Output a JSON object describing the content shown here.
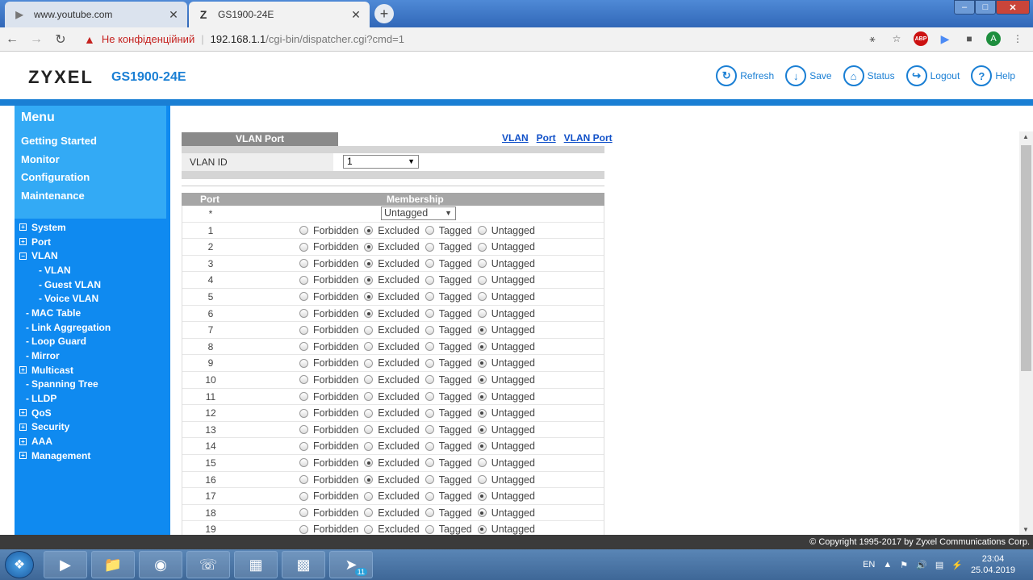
{
  "browser": {
    "tabs": [
      {
        "title": "www.youtube.com",
        "icon": "youtube-icon"
      },
      {
        "title": "GS1900-24E",
        "icon": "zyxel-icon"
      }
    ],
    "new_tab": "+",
    "security_warning": "Не конфіденційний",
    "url_host": "192.168.1.1",
    "url_path": "/cgi-bin/dispatcher.cgi?cmd=1",
    "avatar_letter": "A",
    "abp_label": "ABP"
  },
  "header": {
    "brand": "ZYXEL",
    "model": "GS1900-24E",
    "actions": [
      {
        "label": "Refresh",
        "icon": "refresh-icon"
      },
      {
        "label": "Save",
        "icon": "save-icon"
      },
      {
        "label": "Status",
        "icon": "status-icon"
      },
      {
        "label": "Logout",
        "icon": "logout-icon"
      },
      {
        "label": "Help",
        "icon": "help-icon"
      }
    ]
  },
  "sidebar": {
    "menu_title": "Menu",
    "top_items": [
      "Getting Started",
      "Monitor",
      "Configuration",
      "Maintenance"
    ],
    "tree": [
      {
        "label": "System",
        "type": "plus",
        "indent": 0
      },
      {
        "label": "Port",
        "type": "plus",
        "indent": 0
      },
      {
        "label": "VLAN",
        "type": "minus",
        "indent": 0
      },
      {
        "label": "VLAN",
        "type": "dash",
        "indent": 2
      },
      {
        "label": "Guest VLAN",
        "type": "dash",
        "indent": 2
      },
      {
        "label": "Voice VLAN",
        "type": "dash",
        "indent": 2
      },
      {
        "label": "MAC Table",
        "type": "dash",
        "indent": 1
      },
      {
        "label": "Link Aggregation",
        "type": "dash",
        "indent": 1
      },
      {
        "label": "Loop Guard",
        "type": "dash",
        "indent": 1
      },
      {
        "label": "Mirror",
        "type": "dash",
        "indent": 1
      },
      {
        "label": "Multicast",
        "type": "plus",
        "indent": 0
      },
      {
        "label": "Spanning Tree",
        "type": "dash",
        "indent": 1
      },
      {
        "label": "LLDP",
        "type": "dash",
        "indent": 1
      },
      {
        "label": "QoS",
        "type": "plus",
        "indent": 0
      },
      {
        "label": "Security",
        "type": "plus",
        "indent": 0
      },
      {
        "label": "AAA",
        "type": "plus",
        "indent": 0
      },
      {
        "label": "Management",
        "type": "plus",
        "indent": 0
      }
    ]
  },
  "main": {
    "tab_label": "VLAN Port",
    "links": [
      "VLAN",
      "Port",
      "VLAN Port"
    ],
    "vlan_id_label": "VLAN ID",
    "vlan_id_value": "1",
    "col_port": "Port",
    "col_membership": "Membership",
    "all_row_port": "*",
    "all_row_value": "Untagged",
    "options": [
      "Forbidden",
      "Excluded",
      "Tagged",
      "Untagged"
    ],
    "rows": [
      {
        "port": "1",
        "selected": "Excluded"
      },
      {
        "port": "2",
        "selected": "Excluded"
      },
      {
        "port": "3",
        "selected": "Excluded"
      },
      {
        "port": "4",
        "selected": "Excluded"
      },
      {
        "port": "5",
        "selected": "Excluded"
      },
      {
        "port": "6",
        "selected": "Excluded"
      },
      {
        "port": "7",
        "selected": "Untagged"
      },
      {
        "port": "8",
        "selected": "Untagged"
      },
      {
        "port": "9",
        "selected": "Untagged"
      },
      {
        "port": "10",
        "selected": "Untagged"
      },
      {
        "port": "11",
        "selected": "Untagged"
      },
      {
        "port": "12",
        "selected": "Untagged"
      },
      {
        "port": "13",
        "selected": "Untagged"
      },
      {
        "port": "14",
        "selected": "Untagged"
      },
      {
        "port": "15",
        "selected": "Excluded"
      },
      {
        "port": "16",
        "selected": "Excluded"
      },
      {
        "port": "17",
        "selected": "Untagged"
      },
      {
        "port": "18",
        "selected": "Untagged"
      },
      {
        "port": "19",
        "selected": "Untagged"
      }
    ]
  },
  "footer": {
    "copyright": "© Copyright 1995-2017 by Zyxel Communications Corp."
  },
  "taskbar": {
    "language": "EN",
    "time": "23:04",
    "date": "25.04.2019",
    "telegram_badge": "11"
  },
  "colors": {
    "accent": "#1a7fd4",
    "sidebar": "#0f8af0",
    "menu_box": "#33aaf5"
  }
}
